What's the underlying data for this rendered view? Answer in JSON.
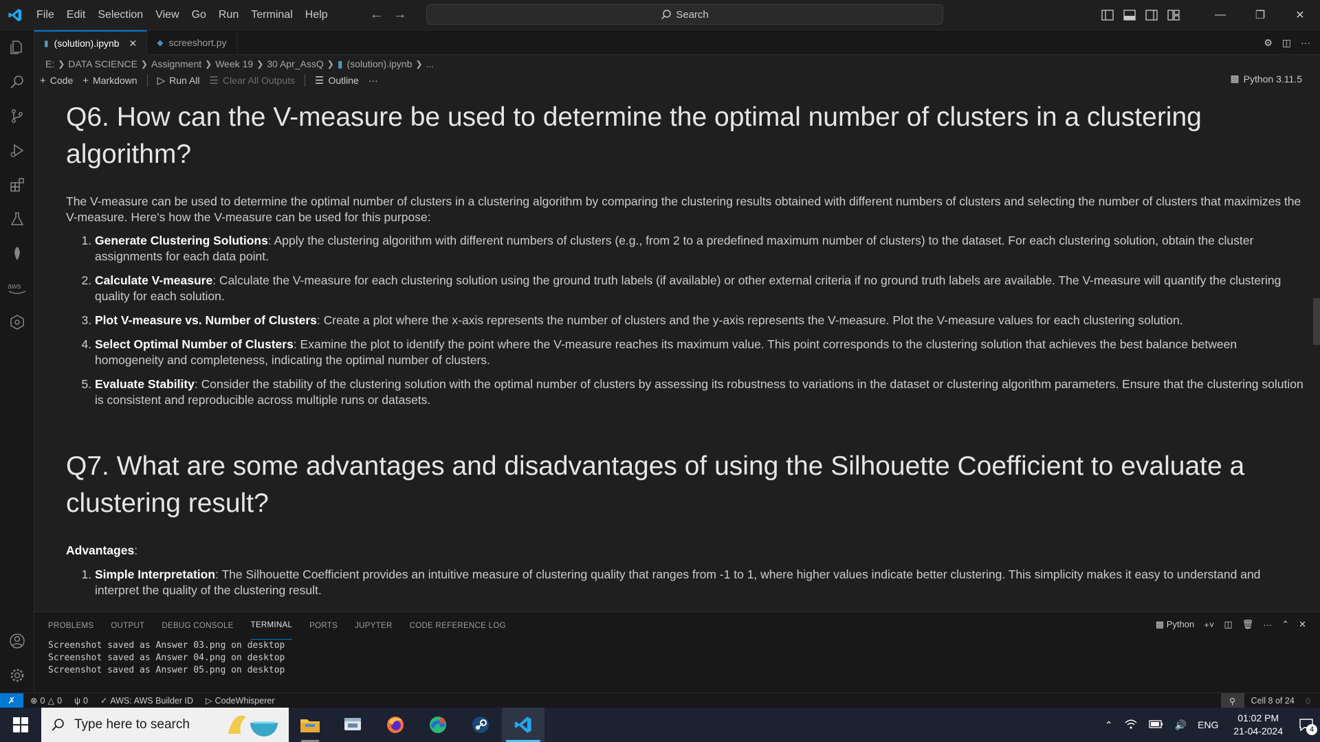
{
  "titlebar": {
    "menu": [
      "File",
      "Edit",
      "Selection",
      "View",
      "Go",
      "Run",
      "Terminal",
      "Help"
    ],
    "search_label": "Search"
  },
  "tabs": [
    {
      "label": "(solution).ipynb",
      "active": true
    },
    {
      "label": "screeshort.py",
      "active": false
    }
  ],
  "breadcrumb": [
    "E:",
    "DATA SCIENCE",
    "Assignment",
    "Week 19",
    "30 Apr_AssQ",
    "(solution).ipynb",
    "..."
  ],
  "toolbar": {
    "code": "Code",
    "markdown": "Markdown",
    "run_all": "Run All",
    "clear_outputs": "Clear All Outputs",
    "outline": "Outline",
    "more": "···",
    "kernel": "Python 3.11.5"
  },
  "content": {
    "q6_title": "Q6. How can the V-measure be used to determine the optimal number of clusters in a clustering algorithm?",
    "q6_intro": "The V-measure can be used to determine the optimal number of clusters in a clustering algorithm by comparing the clustering results obtained with different numbers of clusters and selecting the number of clusters that maximizes the V-measure. Here's how the V-measure can be used for this purpose:",
    "q6_steps": [
      {
        "title": "Generate Clustering Solutions",
        "text": ": Apply the clustering algorithm with different numbers of clusters (e.g., from 2 to a predefined maximum number of clusters) to the dataset. For each clustering solution, obtain the cluster assignments for each data point."
      },
      {
        "title": "Calculate V-measure",
        "text": ": Calculate the V-measure for each clustering solution using the ground truth labels (if available) or other external criteria if no ground truth labels are available. The V-measure will quantify the clustering quality for each solution."
      },
      {
        "title": "Plot V-measure vs. Number of Clusters",
        "text": ": Create a plot where the x-axis represents the number of clusters and the y-axis represents the V-measure. Plot the V-measure values for each clustering solution."
      },
      {
        "title": "Select Optimal Number of Clusters",
        "text": ": Examine the plot to identify the point where the V-measure reaches its maximum value. This point corresponds to the clustering solution that achieves the best balance between homogeneity and completeness, indicating the optimal number of clusters."
      },
      {
        "title": "Evaluate Stability",
        "text": ": Consider the stability of the clustering solution with the optimal number of clusters by assessing its robustness to variations in the dataset or clustering algorithm parameters. Ensure that the clustering solution is consistent and reproducible across multiple runs or datasets."
      }
    ],
    "q7_title": "Q7. What are some advantages and disadvantages of using the Silhouette Coefficient to evaluate a clustering result?",
    "advantages_label": "Advantages",
    "advantages_colon": ":",
    "q7_steps": [
      {
        "title": "Simple Interpretation",
        "text": ": The Silhouette Coefficient provides an intuitive measure of clustering quality that ranges from -1 to 1, where higher values indicate better clustering. This simplicity makes it easy to understand and interpret the quality of the clustering result."
      }
    ]
  },
  "panel": {
    "tabs": [
      "PROBLEMS",
      "OUTPUT",
      "DEBUG CONSOLE",
      "TERMINAL",
      "PORTS",
      "JUPYTER",
      "CODE REFERENCE LOG"
    ],
    "active_tab": "TERMINAL",
    "shell_label": "Python",
    "terminal_lines": [
      "Screenshot saved as Answer 03.png on desktop",
      "Screenshot saved as Answer 04.png on desktop",
      "Screenshot saved as Answer 05.png on desktop"
    ]
  },
  "statusbar": {
    "errors": "0",
    "warnings": "0",
    "ports": "0",
    "aws": "AWS: AWS Builder ID",
    "codewhisperer": "CodeWhisperer",
    "cell": "Cell 8 of 24"
  },
  "taskbar": {
    "search_placeholder": "Type here to search",
    "language": "ENG",
    "time": "01:02 PM",
    "date": "21-04-2024",
    "notifications": "4"
  },
  "colors": {
    "accent": "#0078d4",
    "background": "#1f1f1f"
  }
}
